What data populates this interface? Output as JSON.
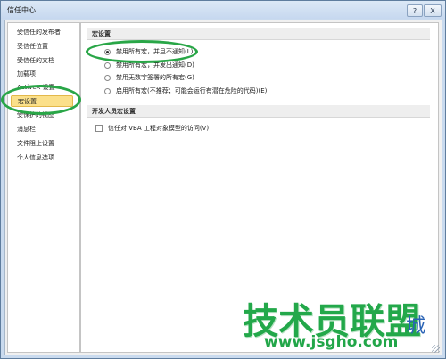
{
  "window": {
    "title": "信任中心",
    "help_label": "?",
    "close_label": "X"
  },
  "sidebar": {
    "items": [
      {
        "label": "受信任的发布者"
      },
      {
        "label": "受信任位置"
      },
      {
        "label": "受信任的文档"
      },
      {
        "label": "加载项"
      },
      {
        "label": "ActiveX 设置"
      },
      {
        "label": "宏设置"
      },
      {
        "label": "受保护的视图"
      },
      {
        "label": "消息栏"
      },
      {
        "label": "文件阻止设置"
      },
      {
        "label": "个人信息选项"
      }
    ],
    "selected_index": 5
  },
  "macro_settings": {
    "header": "宏设置",
    "options": [
      {
        "label": "禁用所有宏，并且不通知(L)",
        "checked": true
      },
      {
        "label": "禁用所有宏，并发出通知(D)",
        "checked": false
      },
      {
        "label": "禁用无数字签署的所有宏(G)",
        "checked": false
      },
      {
        "label": "启用所有宏(不推荐；可能会运行有潜在危险的代码)(E)",
        "checked": false
      }
    ]
  },
  "developer_settings": {
    "header": "开发人员宏设置",
    "vba_trust": {
      "label": "信任对 VBA 工程对象模型的访问(V)",
      "checked": false
    }
  },
  "watermark": {
    "brand": "技术员联盟",
    "url": "www.jsgho.com",
    "city": "城"
  },
  "colors": {
    "highlight_ellipse": "#29a647",
    "selected_item_bg": "#fbe08a",
    "titlebar": "#c6d8ef"
  }
}
